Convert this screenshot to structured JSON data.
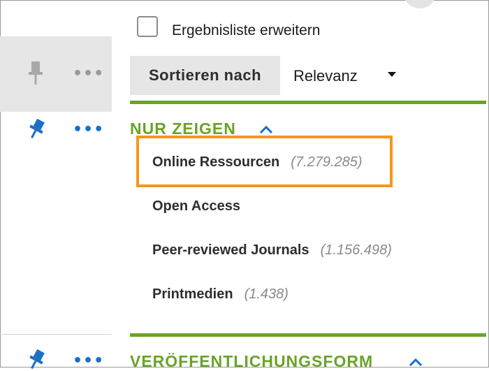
{
  "options": {
    "expand_checkbox_label": "Ergebnisliste erweitern",
    "expand_checked": false
  },
  "sort": {
    "label": "Sortieren nach",
    "value": "Relevanz"
  },
  "show_only": {
    "title": "NUR ZEIGEN",
    "filters": [
      {
        "label": "Online Ressourcen",
        "count": "(7.279.285)",
        "highlighted": true
      },
      {
        "label": "Open Access",
        "count": ""
      },
      {
        "label": "Peer-reviewed Journals",
        "count": "(1.156.498)"
      },
      {
        "label": "Printmedien",
        "count": "(1.438)"
      }
    ]
  },
  "publication_form": {
    "title": "VERÖFFENTLICHUNGSFORM"
  },
  "left_actions": {
    "more_label": "•••"
  },
  "colors": {
    "accent_green": "#6aa329",
    "highlight_orange": "#f7961d",
    "pin_blue": "#1a6fc7",
    "pin_gray": "#a8a8a8"
  }
}
